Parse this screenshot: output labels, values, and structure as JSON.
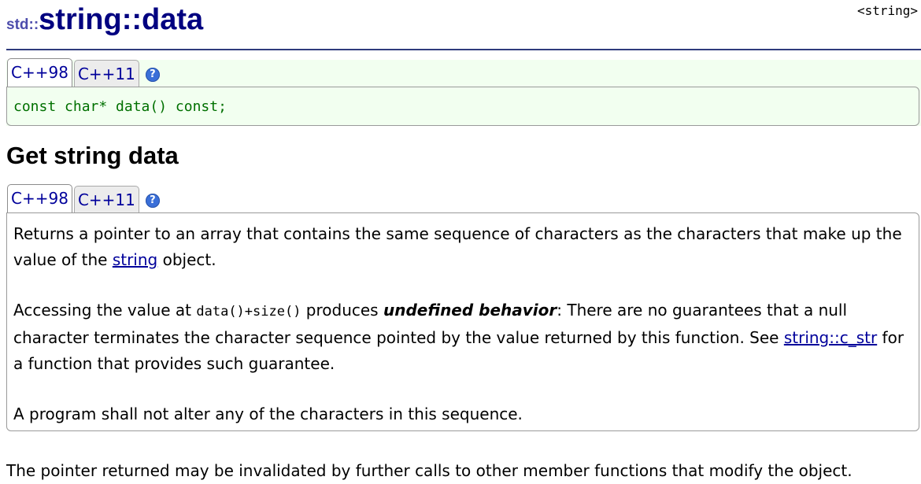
{
  "header": {
    "header_tag": "<string>",
    "title_namespace": "std::",
    "title_class": "string",
    "title_separator": "::",
    "title_member": "data"
  },
  "prototype": {
    "tabs": [
      {
        "label": "C++98",
        "active": true
      },
      {
        "label": "C++11",
        "active": false
      }
    ],
    "help_icon": "question-mark-icon",
    "help_glyph": "?",
    "code": "const char* data() const;"
  },
  "section": {
    "heading": "Get string data",
    "tabs": [
      {
        "label": "C++98",
        "active": true
      },
      {
        "label": "C++11",
        "active": false
      }
    ],
    "help_glyph": "?",
    "p1": {
      "text_before": "Returns a pointer to an array that contains the same sequence of characters as the characters that make up the value of the ",
      "link": "string",
      "text_after": " object."
    },
    "p2": {
      "text_before": "Accessing the value at ",
      "code": "data()+size()",
      "text_mid": " produces ",
      "emphasis": "undefined behavior",
      "text_after": ": There are no guarantees that a null character terminates the character sequence pointed by the value returned by this function. See ",
      "link": "string::c_str",
      "text_end": " for a function that provides such guarantee."
    },
    "p3": "A program shall not alter any of the characters in this sequence."
  },
  "footer": {
    "text": "The pointer returned may be invalidated by further calls to other member functions that modify the object."
  },
  "colors": {
    "title_blue": "#000080",
    "link_blue": "#00009b",
    "code_green": "#007000",
    "prototype_bg": "#f2fff0"
  }
}
